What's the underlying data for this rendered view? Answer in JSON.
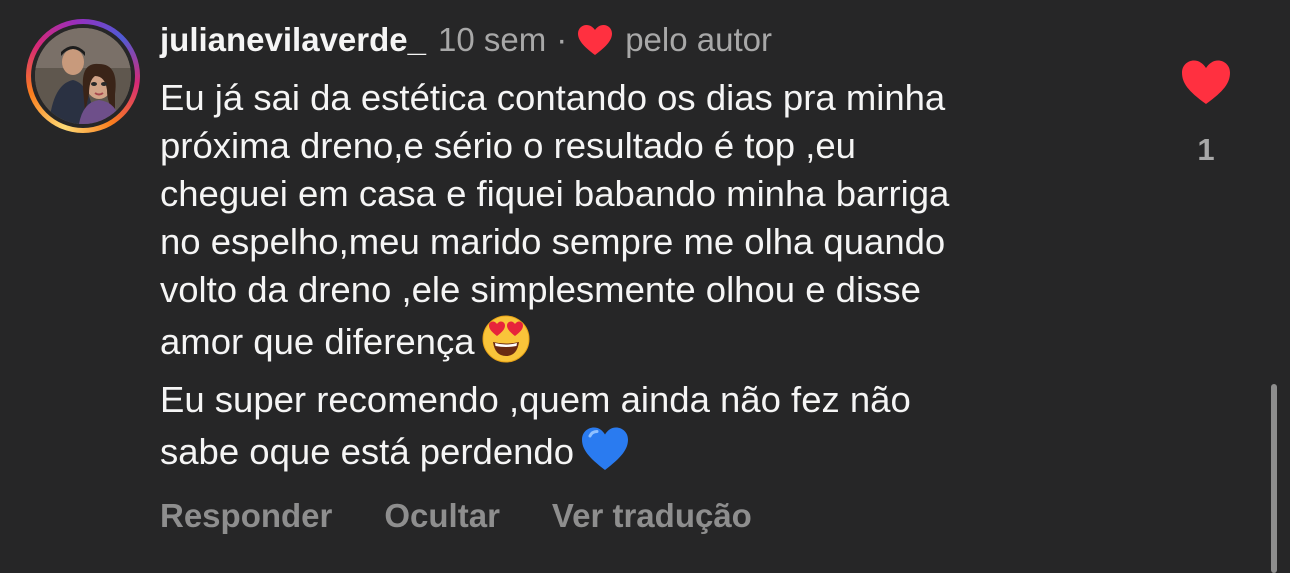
{
  "comment": {
    "username": "julianevilaverde_",
    "time": "10 sem",
    "separator": "·",
    "liked_by_author": "pelo autor",
    "body_paragraph_1_lines": [
      "Eu já sai da estética contando os dias pra minha",
      "próxima dreno,e sério o resultado é top ,eu",
      "cheguei em casa e fiquei babando minha barriga",
      "no espelho,meu marido sempre me olha quando",
      "volto da dreno ,ele simplesmente olhou e disse",
      "amor que diferença"
    ],
    "body_paragraph_2_lines": [
      "Eu super recomendo ,quem ainda não fez não",
      "sabe oque está perdendo"
    ],
    "emoji_1": "heart-eyes-emoji",
    "emoji_2": "blue-heart-emoji",
    "actions": {
      "reply": "Responder",
      "hide": "Ocultar",
      "translate": "Ver tradução"
    },
    "likes": {
      "count": "1",
      "liked": true
    }
  },
  "colors": {
    "background": "#262627",
    "text": "#f5f5f5",
    "muted": "#a8a8a8",
    "action": "#8e8e8e",
    "like_red": "#ff3040",
    "blue_heart": "#2a7bf0"
  }
}
